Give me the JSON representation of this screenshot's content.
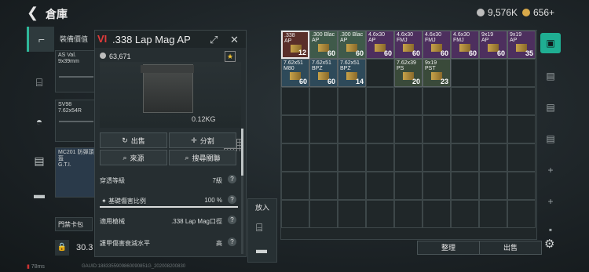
{
  "header": {
    "back_icon": "chevron-left-icon",
    "title": "倉庫",
    "silver": "9,576K",
    "gold": "656+"
  },
  "leftnav": [
    {
      "icon": "pistol-icon",
      "active": true
    },
    {
      "icon": "vest-icon",
      "active": false
    },
    {
      "icon": "helmet-icon",
      "active": false
    },
    {
      "icon": "backpack-icon",
      "active": false
    },
    {
      "icon": "toolbox-icon",
      "active": false
    }
  ],
  "equip": {
    "header": "裝備價值",
    "slot1": "AS Val.\n9x39mm",
    "slot2": "SV98\n7.62x54R",
    "slot3": "MC201 防彈頭盔\nG.T.I.",
    "keycard": "門禁卡包",
    "capacity": "30.3"
  },
  "detail": {
    "tier": "VI",
    "name": ".338 Lap Mag AP",
    "value": "63,671",
    "weight": "0.12KG",
    "buttons": {
      "sell": "出售",
      "split": "分割",
      "source": "來源",
      "search": "搜尋關聯"
    },
    "stats": [
      {
        "label": "穿透等級",
        "value": "7級"
      },
      {
        "label": "基礎傷害比例",
        "value": "100 %",
        "fraction": 1.0
      },
      {
        "label": "適用槍械",
        "value": ".338 Lap Mag口徑"
      },
      {
        "label": "護甲傷害衰減水平",
        "value": "高"
      }
    ]
  },
  "putin": {
    "label": "放入"
  },
  "stash": {
    "items": [
      {
        "name": ".338\nAP",
        "count": "12",
        "color": "#5a2f2a",
        "selected": true,
        "col": 0,
        "row": 0
      },
      {
        "name": ".300 Blac\nAP",
        "count": "60",
        "color": "#3f5a4a",
        "col": 1,
        "row": 0
      },
      {
        "name": ".300 Blac\nAP",
        "count": "60",
        "color": "#3f5a4a",
        "col": 2,
        "row": 0
      },
      {
        "name": "4.6x30\nAP",
        "count": "60",
        "color": "#4d2f5e",
        "col": 3,
        "row": 0
      },
      {
        "name": "4.6x30\nFMJ",
        "count": "60",
        "color": "#4d2f5e",
        "col": 4,
        "row": 0
      },
      {
        "name": "4.6x30\nFMJ",
        "count": "60",
        "color": "#4d2f5e",
        "col": 5,
        "row": 0
      },
      {
        "name": "4.6x30\nFMJ",
        "count": "60",
        "color": "#4d2f5e",
        "col": 6,
        "row": 0
      },
      {
        "name": "9x19\nAP",
        "count": "60",
        "color": "#4d2f5e",
        "col": 7,
        "row": 0
      },
      {
        "name": "9x19\nAP",
        "count": "35",
        "color": "#4d2f5e",
        "col": 8,
        "row": 0
      },
      {
        "name": "7.62x51\nM80",
        "count": "60",
        "color": "#2e4a5a",
        "col": 0,
        "row": 1
      },
      {
        "name": "7.62x51\nBPZ",
        "count": "60",
        "color": "#2e4a5a",
        "col": 1,
        "row": 1
      },
      {
        "name": "7.62x51\nBPZ",
        "count": "14",
        "color": "#2e4a5a",
        "col": 2,
        "row": 1
      },
      {
        "name": "7.62x39\nPS",
        "count": "20",
        "color": "#3a4a3a",
        "col": 4,
        "row": 1
      },
      {
        "name": "9x19\nPST",
        "count": "23",
        "color": "#3a4a3a",
        "col": 5,
        "row": 1
      }
    ]
  },
  "rail": [
    {
      "icon": "stash-icon",
      "active": true
    },
    {
      "icon": "container-icon",
      "active": false
    },
    {
      "icon": "container-icon",
      "active": false
    },
    {
      "icon": "container-icon",
      "active": false
    },
    {
      "icon": "plus-icon",
      "active": false
    },
    {
      "icon": "plus-icon",
      "active": false
    },
    {
      "icon": "lock-icon",
      "active": false
    }
  ],
  "bottom": {
    "sort": "整理",
    "sell": "出售"
  },
  "status": {
    "ping": "78ms",
    "uid": "GAUID:1883355909860090851G_202008200830"
  }
}
